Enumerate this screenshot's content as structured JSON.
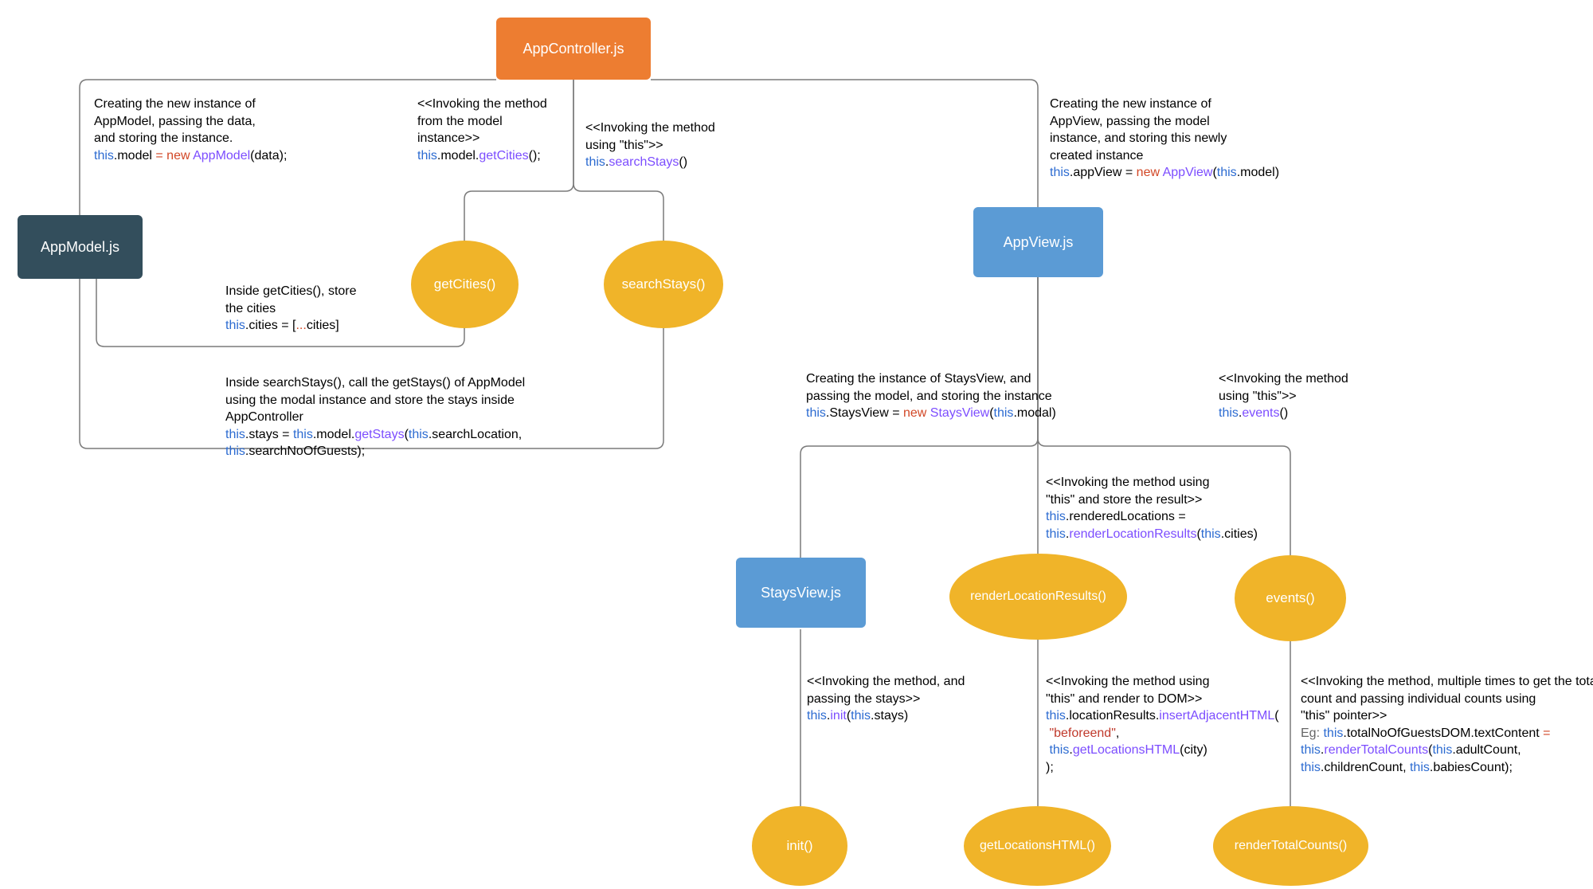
{
  "nodes": {
    "appController": "AppController.js",
    "appModel": "AppModel.js",
    "appView": "AppView.js",
    "staysView": "StaysView.js",
    "getCities": "getCities()",
    "searchStays": "searchStays()",
    "renderLocationResults": "renderLocationResults()",
    "events": "events()",
    "init": "init()",
    "getLocationsHTML": "getLocationsHTML()",
    "renderTotalCounts": "renderTotalCounts()"
  },
  "annotations": {
    "a1_l1": "Creating the new instance of",
    "a1_l2": "AppModel, passing the data,",
    "a1_l3": "and storing the instance.",
    "a1_code_this1": "this",
    "a1_code_model": ".model ",
    "a1_code_eq": "= ",
    "a1_code_new": "new ",
    "a1_code_type": "AppModel",
    "a1_code_args": "(data);",
    "a2_l1": "<<Invoking the method",
    "a2_l2": "from the model",
    "a2_l3": "instance>>",
    "a2_code_this": "this",
    "a2_code_rest": ".model.",
    "a2_code_call": "getCities",
    "a2_code_end": "();",
    "a3_l1": "<<Invoking the method",
    "a3_l2": "using \"this\">>",
    "a3_code_this": "this",
    "a3_code_dot": ".",
    "a3_code_call": "searchStays",
    "a3_code_end": "()",
    "a4_l1": "Creating the new instance of",
    "a4_l2": "AppView, passing the model",
    "a4_l3": "instance, and storing this newly",
    "a4_l4": "created instance",
    "a4_code_this1": "this",
    "a4_code_p1": ".appView = ",
    "a4_code_new": "new ",
    "a4_code_type": "AppView",
    "a4_code_open": "(",
    "a4_code_this2": "this",
    "a4_code_p2": ".model)",
    "a5_l1": "Inside getCities(), store",
    "a5_l2": "the cities",
    "a5_code_this": "this",
    "a5_code_p": ".cities = [",
    "a5_code_spread": "...",
    "a5_code_end": "cities]",
    "a6_l1": "Inside searchStays(), call the getStays() of AppModel",
    "a6_l2": "using the modal instance and store the stays inside",
    "a6_l3": "AppController",
    "a6_code_this1": "this",
    "a6_code_p1": ".stays = ",
    "a6_code_this2": "this",
    "a6_code_p2": ".model.",
    "a6_code_call": "getStays",
    "a6_code_open": "(",
    "a6_code_this3": "this",
    "a6_code_p3": ".searchLocation,",
    "a6_code_this4": "this",
    "a6_code_p4": ".searchNoOfGuests);",
    "a7_l1": "Creating the instance of StaysView, and",
    "a7_l2": "passing the model, and storing the instance",
    "a7_code_this1": "this",
    "a7_code_p1": ".StaysView = ",
    "a7_code_new": "new ",
    "a7_code_type": "StaysView",
    "a7_code_open": "(",
    "a7_code_this2": "this",
    "a7_code_p2": ".modal)",
    "a8_l1": "<<Invoking the method",
    "a8_l2": "using \"this\">>",
    "a8_code_this": "this",
    "a8_code_dot": ".",
    "a8_code_call": "events",
    "a8_code_end": "()",
    "a9_l1": "<<Invoking the method using",
    "a9_l2": "\"this\" and store the result>>",
    "a9_code_this1": "this",
    "a9_code_p1": ".renderedLocations =",
    "a9_code_this2": "this",
    "a9_code_dot": ".",
    "a9_code_call": "renderLocationResults",
    "a9_code_open": "(",
    "a9_code_this3": "this",
    "a9_code_p2": ".cities)",
    "a10_l1": "<<Invoking the method, and",
    "a10_l2": "passing the stays>>",
    "a10_code_this1": "this",
    "a10_code_dot": ".",
    "a10_code_call": "init",
    "a10_code_open": "(",
    "a10_code_this2": "this",
    "a10_code_p": ".stays)",
    "a11_l1": "<<Invoking the method using",
    "a11_l2": "\"this\" and render to DOM>>",
    "a11_code_this1": "this",
    "a11_code_p1": ".locationResults.",
    "a11_code_call1": "insertAdjacentHTML",
    "a11_code_open": "(",
    "a11_code_str": "\"beforeend\"",
    "a11_code_comma": ",",
    "a11_code_this2": "this",
    "a11_code_dot": ".",
    "a11_code_call2": "getLocationsHTML",
    "a11_code_args": "(city)",
    "a11_code_close": ");",
    "a12_l1": "<<Invoking the method, multiple times to get the total",
    "a12_l2": "count and passing individual counts using",
    "a12_l3": "\"this\" pointer>>",
    "a12_code_eg": "Eg: ",
    "a12_code_this1": "this",
    "a12_code_p1": ".totalNoOfGuestsDOM.textContent ",
    "a12_code_eq": "= ",
    "a12_code_this2": "this",
    "a12_code_dot": ".",
    "a12_code_call": "renderTotalCounts",
    "a12_code_open": "(",
    "a12_code_this3": "this",
    "a12_code_p2": ".adultCount,",
    "a12_code_this4": "this",
    "a12_code_p3": ".childrenCount, ",
    "a12_code_this5": "this",
    "a12_code_p4": ".babiesCount);"
  }
}
